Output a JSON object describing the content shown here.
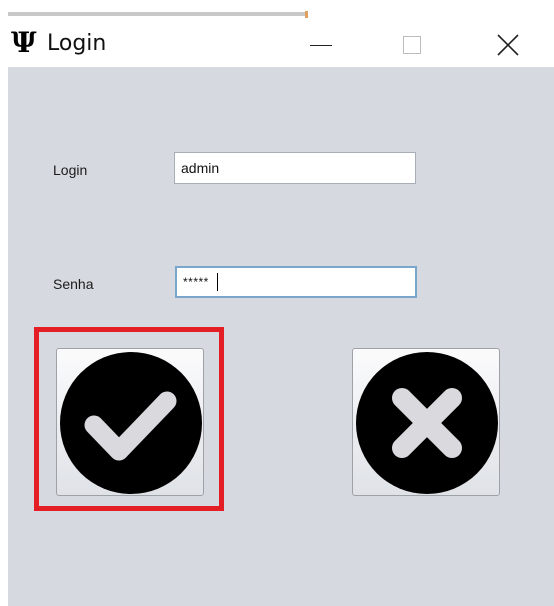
{
  "window": {
    "title": "Login",
    "icon": "Ψ",
    "controls": {
      "minimize": "minimize-icon",
      "maximize": "maximize-icon",
      "close": "close-icon"
    }
  },
  "form": {
    "login_label": "Login",
    "login_value": "admin",
    "password_label": "Senha",
    "password_value": "*****"
  },
  "buttons": {
    "confirm": "check-icon",
    "cancel": "x-icon"
  },
  "colors": {
    "highlight": "#e31e24",
    "window_bg": "#d6d9e0",
    "focus_border": "#7ba6cc"
  }
}
